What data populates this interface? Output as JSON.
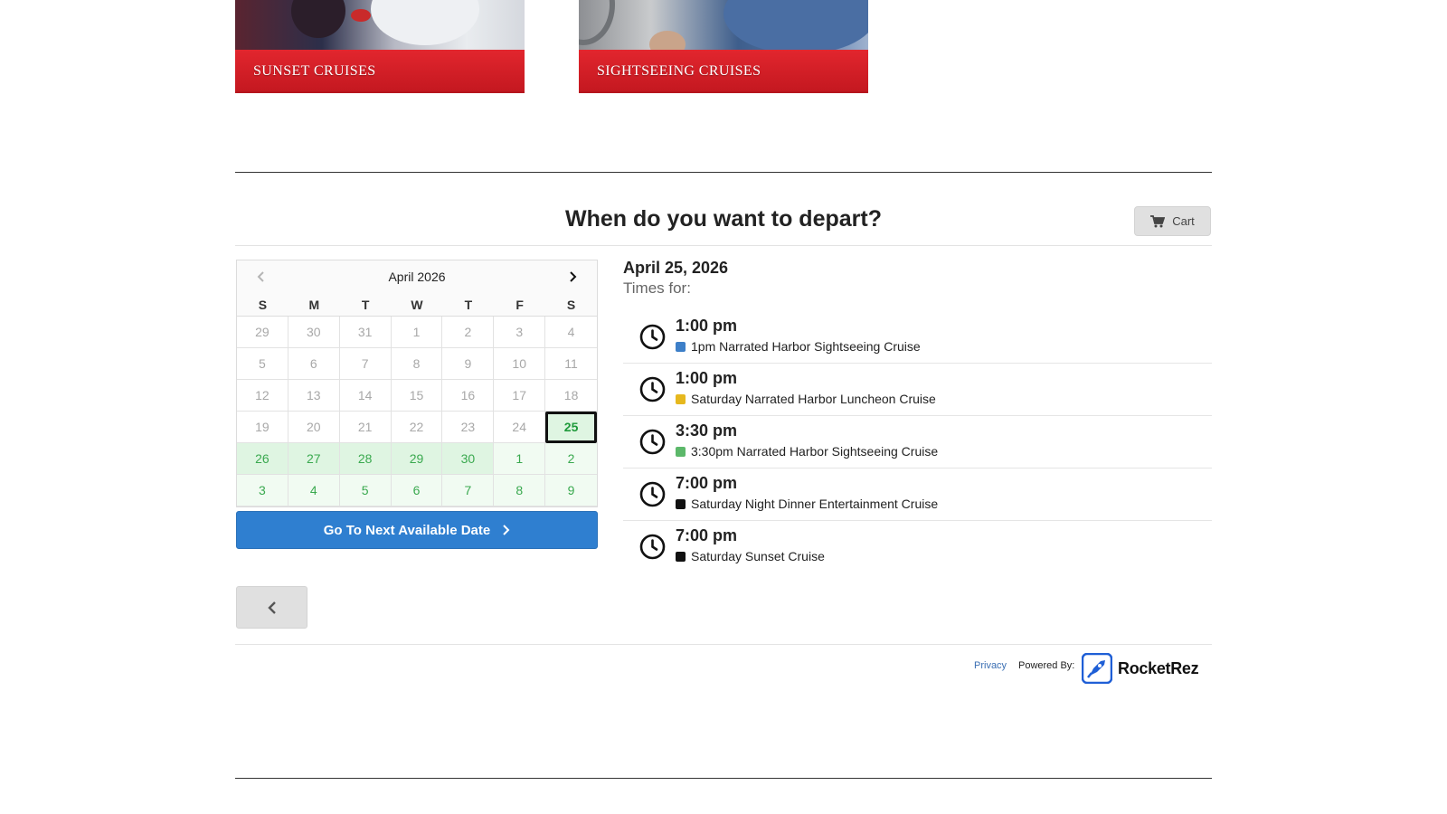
{
  "tiles": [
    {
      "label": "SUNSET CRUISES"
    },
    {
      "label": "SIGHTSEEING CRUISES"
    }
  ],
  "heading": "When do you want to depart?",
  "cart": {
    "label": "Cart",
    "icon": "cart-icon"
  },
  "calendar": {
    "month_label": "April 2026",
    "prev_icon": "chevron-left-icon",
    "next_icon": "chevron-right-icon",
    "weekdays": [
      "S",
      "M",
      "T",
      "W",
      "T",
      "F",
      "S"
    ],
    "days": [
      "29",
      "30",
      "31",
      "1",
      "2",
      "3",
      "4",
      "5",
      "6",
      "7",
      "8",
      "9",
      "10",
      "11",
      "12",
      "13",
      "14",
      "15",
      "16",
      "17",
      "18",
      "19",
      "20",
      "21",
      "22",
      "23",
      "24",
      "25",
      "26",
      "27",
      "28",
      "29",
      "30",
      "1",
      "2",
      "3",
      "4",
      "5",
      "6",
      "7",
      "8",
      "9"
    ],
    "selected": "25"
  },
  "next_available": {
    "label": "Go To Next Available Date",
    "icon": "chevron-right-icon"
  },
  "selected_date": "April 25, 2026",
  "times_for": "Times for:",
  "times": [
    {
      "time": "1:00 pm",
      "name": "1pm Narrated Harbor Sightseeing Cruise",
      "color": "#3d7fc8"
    },
    {
      "time": "1:00 pm",
      "name": "Saturday Narrated Harbor Luncheon Cruise",
      "color": "#e6b81e"
    },
    {
      "time": "3:30 pm",
      "name": "3:30pm Narrated Harbor Sightseeing Cruise",
      "color": "#5cb86a"
    },
    {
      "time": "7:00 pm",
      "name": "Saturday Night Dinner Entertainment Cruise",
      "color": "#111111"
    },
    {
      "time": "7:00 pm",
      "name": "Saturday Sunset Cruise",
      "color": "#111111"
    }
  ],
  "back_button": {
    "icon": "chevron-left-icon"
  },
  "footer": {
    "privacy": "Privacy",
    "powered_by": "Powered By:",
    "logo_text": "RocketRez"
  },
  "colors": {
    "tile_red": "#d81f27",
    "primary_blue": "#2f7fd0",
    "available_green": "#3aa94f"
  }
}
